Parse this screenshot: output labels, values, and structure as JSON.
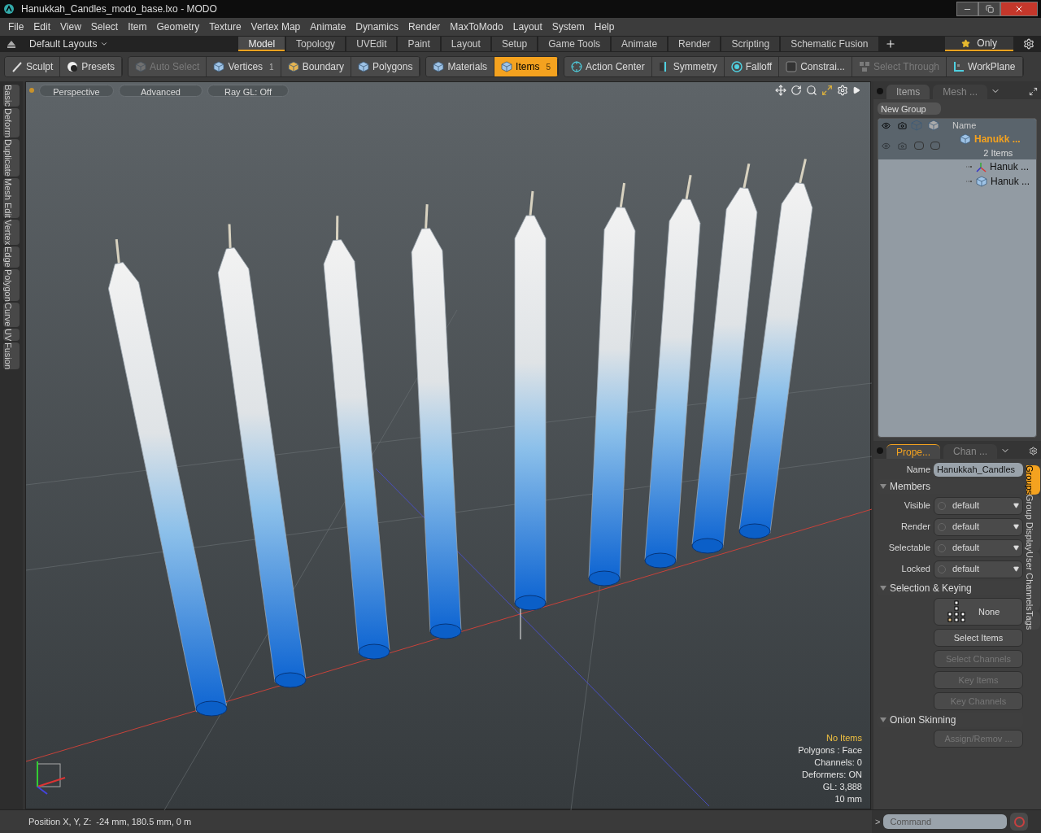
{
  "window": {
    "title": "Hanukkah_Candles_modo_base.lxo - MODO"
  },
  "menu": [
    "File",
    "Edit",
    "View",
    "Select",
    "Item",
    "Geometry",
    "Texture",
    "Vertex Map",
    "Animate",
    "Dynamics",
    "Render",
    "MaxToModo",
    "Layout",
    "System",
    "Help"
  ],
  "layout_bar": {
    "layouts": "Default Layouts",
    "only": "Only",
    "tabs": [
      {
        "label": "Model",
        "selected": true
      },
      {
        "label": "Topology",
        "selected": false
      },
      {
        "label": "UVEdit",
        "selected": false
      },
      {
        "label": "Paint",
        "selected": false
      },
      {
        "label": "Layout",
        "selected": false
      },
      {
        "label": "Setup",
        "selected": false
      },
      {
        "label": "Game Tools",
        "selected": false
      },
      {
        "label": "Animate",
        "selected": false
      },
      {
        "label": "Render",
        "selected": false
      },
      {
        "label": "Scripting",
        "selected": false
      },
      {
        "label": "Schematic Fusion",
        "selected": false
      }
    ]
  },
  "toolbar": [
    [
      {
        "label": "Sculpt",
        "disabled": false,
        "selected": false
      },
      {
        "label": "Presets",
        "disabled": false,
        "selected": false
      }
    ],
    [
      {
        "label": "Auto Select",
        "disabled": true,
        "selected": false
      },
      {
        "label": "Vertices",
        "count": "1",
        "disabled": false,
        "selected": false
      },
      {
        "label": "Boundary",
        "disabled": false,
        "selected": false
      },
      {
        "label": "Polygons",
        "disabled": false,
        "selected": false
      }
    ],
    [
      {
        "label": "Materials",
        "disabled": false,
        "selected": false
      },
      {
        "label": "Items",
        "count": "5",
        "disabled": false,
        "selected": true
      }
    ],
    [
      {
        "label": "Action Center",
        "disabled": false,
        "selected": false
      },
      {
        "label": "Symmetry",
        "disabled": false,
        "selected": false
      },
      {
        "label": "Falloff",
        "disabled": false,
        "selected": false
      },
      {
        "label": "Constrai...",
        "disabled": false,
        "selected": false
      },
      {
        "label": "Select Through",
        "disabled": true,
        "selected": false
      },
      {
        "label": "WorkPlane",
        "disabled": false,
        "selected": false
      }
    ]
  ],
  "left_tabs": [
    "Basic",
    "Deform",
    "Duplicate",
    "Mesh Edit",
    "Vertex",
    "Edge",
    "Polygon",
    "Curve",
    "UV",
    "Fusion"
  ],
  "viewport": {
    "tabs": [
      "Perspective",
      "Advanced",
      "Ray GL: Off"
    ],
    "selection": "No Items",
    "info": [
      "Polygons : Face",
      "Channels: 0",
      "Deformers: ON",
      "GL: 3,888",
      "10 mm"
    ]
  },
  "items_panel": {
    "tabs": [
      {
        "label": "Items",
        "selected": true
      },
      {
        "label": "Mesh ...",
        "selected": false
      }
    ],
    "new_group": "New Group",
    "column": "Name",
    "tree": [
      {
        "name": "Hanukk ...",
        "subtitle": "2 Items",
        "selected": true,
        "children": [
          {
            "name": "Hanuk ...",
            "kind": "locator"
          },
          {
            "name": "Hanuk ...",
            "kind": "mesh"
          }
        ]
      }
    ]
  },
  "properties": {
    "tabs": [
      {
        "label": "Prope...",
        "selected": true
      },
      {
        "label": "Chan ...",
        "selected": false
      }
    ],
    "name_label": "Name",
    "name_value": "Hanukkah_Candles",
    "members": {
      "title": "Members",
      "expanded": true,
      "rows": [
        {
          "label": "Visible",
          "value": "default"
        },
        {
          "label": "Render",
          "value": "default"
        },
        {
          "label": "Selectable",
          "value": "default"
        },
        {
          "label": "Locked",
          "value": "default"
        }
      ]
    },
    "keying": {
      "title": "Selection & Keying",
      "expanded": true,
      "preset": "None",
      "buttons": [
        {
          "label": "Select Items",
          "disabled": false
        },
        {
          "label": "Select Channels",
          "disabled": true
        },
        {
          "label": "Key Items",
          "disabled": true
        },
        {
          "label": "Key Channels",
          "disabled": true
        }
      ]
    },
    "onion": {
      "title": "Onion Skinning",
      "expanded": true,
      "buttons": [
        {
          "label": "Assign/Remov ...",
          "disabled": true
        }
      ]
    },
    "side_tabs": [
      {
        "label": "Groups",
        "selected": true
      },
      {
        "label": "Group Display",
        "selected": false
      },
      {
        "label": "User Channels",
        "selected": false
      },
      {
        "label": "Tags",
        "selected": false
      }
    ]
  },
  "status": {
    "position": "Position X, Y, Z:  -24 mm, 180.5 mm, 0 m",
    "prompt": ">",
    "command_placeholder": "Command"
  }
}
